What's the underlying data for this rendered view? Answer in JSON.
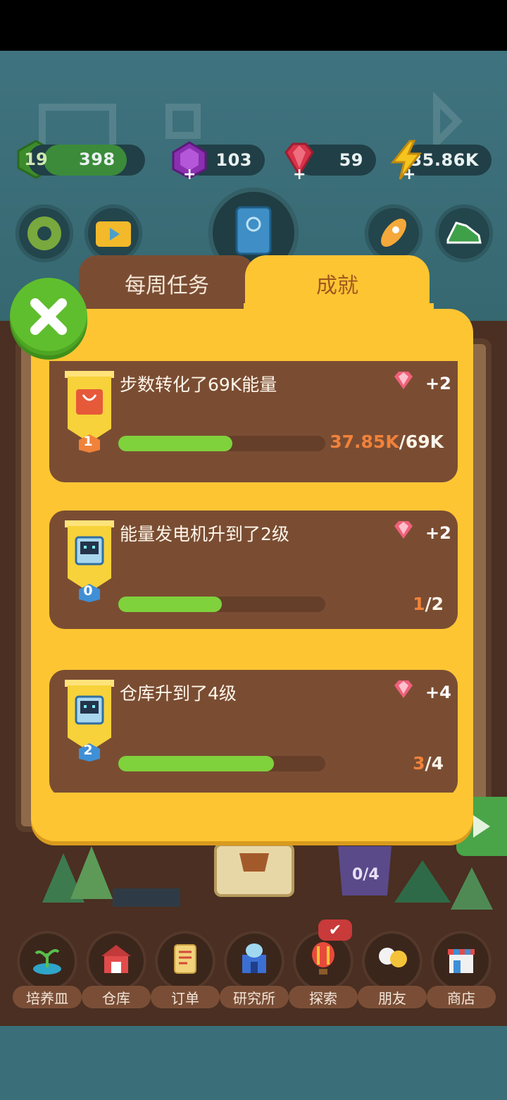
{
  "hud": {
    "level": "19",
    "xp": "398",
    "gems_purple": "103",
    "gems_red": "59",
    "energy": "35.86K"
  },
  "tabs": {
    "weekly": "每周任务",
    "achievements": "成就"
  },
  "achievements": [
    {
      "title": "步数转化了69K能量",
      "reward": "+2",
      "level": "1",
      "progress_current": "37.85K",
      "progress_total": "/69K",
      "fraction": 0.55,
      "icon": "shopping-bag-icon"
    },
    {
      "title": "能量发电机升到了2级",
      "reward": "+2",
      "level": "0",
      "progress_current": "1",
      "progress_total": "/2",
      "fraction": 0.5,
      "icon": "robot-icon"
    },
    {
      "title": "仓库升到了4级",
      "reward": "+4",
      "level": "2",
      "progress_current": "3",
      "progress_total": "/4",
      "fraction": 0.75,
      "icon": "robot-icon"
    }
  ],
  "board": {
    "trophy_counter": "0/4"
  },
  "nav": [
    {
      "label": "培养皿",
      "icon": "sprout-icon"
    },
    {
      "label": "仓库",
      "icon": "barn-icon"
    },
    {
      "label": "订单",
      "icon": "scroll-icon"
    },
    {
      "label": "研究所",
      "icon": "lab-icon"
    },
    {
      "label": "探索",
      "icon": "balloon-icon"
    },
    {
      "label": "朋友",
      "icon": "friends-icon"
    },
    {
      "label": "商店",
      "icon": "shop-icon"
    }
  ],
  "colors": {
    "panel": "#fec533",
    "card": "#7a4d33",
    "progress": "#7fd23c",
    "close": "#5fbe2d"
  }
}
